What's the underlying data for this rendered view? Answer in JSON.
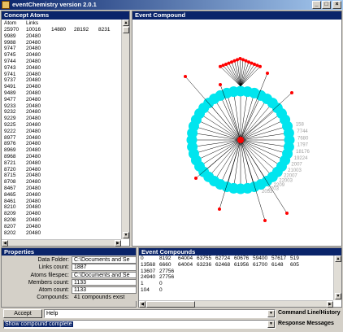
{
  "window": {
    "title": "eventChemistry  version 2.0.1",
    "min": "_",
    "max": "□",
    "close": "×"
  },
  "concept_atoms": {
    "header": "Concept Atoms",
    "columns": [
      "Atom",
      "Links"
    ],
    "rows": [
      [
        "25970",
        "10016",
        "14880",
        "28192",
        "8231"
      ],
      [
        "9989",
        "20480"
      ],
      [
        "9988",
        "20480"
      ],
      [
        "9747",
        "20480"
      ],
      [
        "9745",
        "20480"
      ],
      [
        "9744",
        "20480"
      ],
      [
        "9743",
        "20480"
      ],
      [
        "9741",
        "20480"
      ],
      [
        "9737",
        "20480"
      ],
      [
        "9491",
        "20480"
      ],
      [
        "9489",
        "20480"
      ],
      [
        "9477",
        "20480"
      ],
      [
        "9233",
        "20480"
      ],
      [
        "9232",
        "20480"
      ],
      [
        "9229",
        "20480"
      ],
      [
        "9225",
        "20480"
      ],
      [
        "9222",
        "20480"
      ],
      [
        "8977",
        "20480"
      ],
      [
        "8976",
        "20480"
      ],
      [
        "8969",
        "20480"
      ],
      [
        "8968",
        "20480"
      ],
      [
        "8721",
        "20480"
      ],
      [
        "8720",
        "20480"
      ],
      [
        "8715",
        "20480"
      ],
      [
        "8708",
        "20480"
      ],
      [
        "8467",
        "20480"
      ],
      [
        "8465",
        "20480"
      ],
      [
        "8461",
        "20480"
      ],
      [
        "8210",
        "20480"
      ],
      [
        "8209",
        "20480"
      ],
      [
        "8208",
        "20480"
      ],
      [
        "8207",
        "20480"
      ],
      [
        "8202",
        "20480"
      ]
    ]
  },
  "event_compound": {
    "header": "Event Compound",
    "labels": [
      "158",
      "7744",
      "7680",
      "1797",
      "18176",
      "19224",
      "2007",
      "21003",
      "22007",
      "22003",
      "2209",
      "2203",
      "2053"
    ]
  },
  "properties": {
    "header": "Properties",
    "rows": [
      {
        "label": "Data Folder:",
        "value": "C:\\Documents and Se"
      },
      {
        "label": "Links count:",
        "value": "1887"
      },
      {
        "label": "Atoms filespec:",
        "value": "C:\\Documents and Se"
      },
      {
        "label": "Members count:",
        "value": "1133"
      },
      {
        "label": "Atom count:",
        "value": "1133"
      },
      {
        "label": "Compounds:",
        "value": "41 compounds exist"
      }
    ]
  },
  "event_compounds": {
    "header": "Event Compounds",
    "rows": [
      [
        "0",
        "8192",
        "64004",
        "63755",
        "62724",
        "60676",
        "59400",
        "57617",
        "519"
      ],
      [
        "13568",
        "6660",
        "64004",
        "63236",
        "62468",
        "61956",
        "61700",
        "6148",
        "605"
      ],
      [
        "13607",
        "27756"
      ],
      [
        "24940",
        "27756"
      ],
      [
        "1",
        "0"
      ],
      [
        "104",
        "0"
      ]
    ]
  },
  "command": {
    "accept_label": "Accept",
    "input_value": "Help",
    "caption": "Command Line/History"
  },
  "response": {
    "value": "Show compound complete",
    "caption": "Response Messages"
  },
  "colors": {
    "ring": "#00e5ee",
    "node": "#ff0000",
    "title_bg": "#0a246a"
  }
}
